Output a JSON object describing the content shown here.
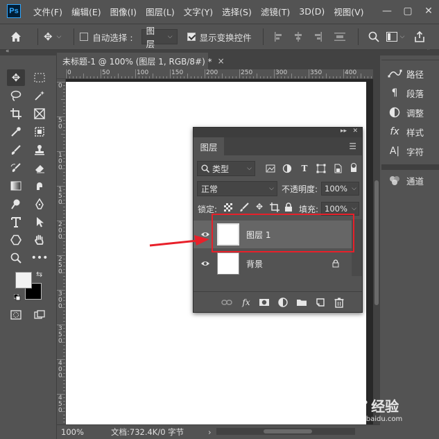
{
  "menubar": {
    "logo": "Ps",
    "items": [
      "文件(F)",
      "编辑(E)",
      "图像(I)",
      "图层(L)",
      "文字(Y)",
      "选择(S)",
      "滤镜(T)",
      "3D(D)",
      "视图(V)"
    ],
    "minimize": "—",
    "maximize": "▢",
    "close": "✕"
  },
  "options": {
    "auto_select_label": "自动选择 :",
    "auto_select_checked": false,
    "auto_select_target": "图层",
    "show_transform_label": "显示变换控件",
    "show_transform_checked": true
  },
  "document": {
    "tab_title": "未标题-1 @ 100% (图层 1, RGB/8#) *",
    "close": "×"
  },
  "rulers": {
    "h_labels": [
      "0",
      "50",
      "100",
      "150",
      "200",
      "250",
      "300",
      "350",
      "400"
    ],
    "v_labels": [
      "0",
      "5 0",
      "1 0 0",
      "1 5 0",
      "2 0 0",
      "2 5 0",
      "3 0 0",
      "3 5 0",
      "4 0 0",
      "4 5 0"
    ]
  },
  "status": {
    "zoom": "100%",
    "doc_info": "文档:732.4K/0 字节",
    "arrow": "›"
  },
  "dock": {
    "items": [
      {
        "icon": "paths-icon",
        "label": "路径"
      },
      {
        "icon": "paragraph-icon",
        "label": "段落"
      },
      {
        "icon": "adjustments-icon",
        "label": "调整"
      },
      {
        "icon": "styles-icon",
        "label": "样式"
      },
      {
        "icon": "character-icon",
        "label": "字符"
      },
      {
        "icon": "channels-icon",
        "label": "通道"
      }
    ]
  },
  "layers_panel": {
    "tab": "图层",
    "filter_kind": "类型",
    "blend_mode": "正常",
    "opacity_label": "不透明度:",
    "opacity_value": "100%",
    "lock_label": "锁定:",
    "fill_label": "填充:",
    "fill_value": "100%",
    "layers": [
      {
        "name": "图层 1",
        "selected": true,
        "locked": false
      },
      {
        "name": "背景",
        "selected": false,
        "locked": true
      }
    ]
  },
  "watermark": {
    "brand": "Bai",
    "brand2": "经验",
    "url": "jingyan.baidu.com"
  },
  "colors": {
    "highlight": "#e8202a",
    "ps_blue": "#31a8ff"
  }
}
